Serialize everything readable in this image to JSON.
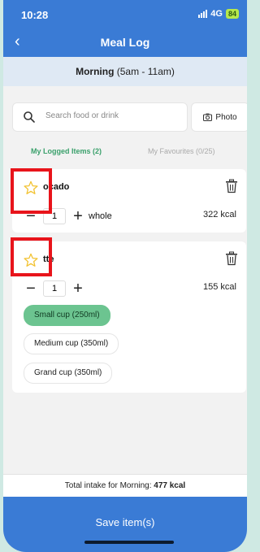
{
  "status": {
    "time": "10:28",
    "network": "4G",
    "battery": "84"
  },
  "header": {
    "back_symbol": "‹",
    "title": "Meal Log"
  },
  "period": {
    "name": "Morning",
    "range": " (5am - 11am)"
  },
  "search": {
    "placeholder": "Search food or drink",
    "photo_label": "Photo"
  },
  "tabs": [
    {
      "label": "My Logged Items (2)",
      "active": true
    },
    {
      "label": "My Favourites (0/25)",
      "active": false
    }
  ],
  "items": [
    {
      "name": "Avocado",
      "name_visible": "ocado",
      "quantity": "1",
      "unit": "whole",
      "kcal": "322 kcal"
    },
    {
      "name": "Latte",
      "name_visible": "tte",
      "quantity": "1",
      "kcal": "155 kcal",
      "options": [
        "Small cup (250ml)",
        "Medium cup (350ml)",
        "Grand cup (350ml)"
      ],
      "selected_option": "Small cup (250ml)"
    }
  ],
  "total": {
    "label": "Total intake for Morning: ",
    "value": "477 kcal"
  },
  "save": {
    "label": "Save item(s)"
  },
  "colors": {
    "primary": "#3a7bd5",
    "accent_green": "#3aa06b",
    "chip_selected": "#6cc490",
    "highlight": "#e8141b"
  }
}
